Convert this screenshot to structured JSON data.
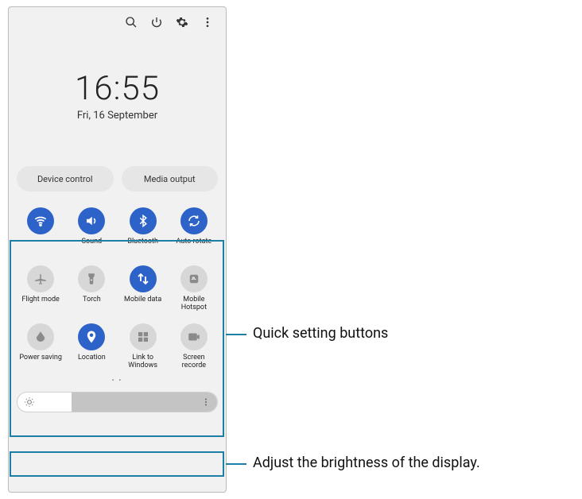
{
  "header": {
    "time": "16:55",
    "date": "Fri, 16 September"
  },
  "chips": {
    "device_control": "Device control",
    "media_output": "Media output"
  },
  "qs": [
    {
      "id": "wifi",
      "label": "",
      "icon": "wifi",
      "on": true
    },
    {
      "id": "sound",
      "label": "Sound",
      "icon": "volume",
      "on": true
    },
    {
      "id": "bluetooth",
      "label": "Bluetooth",
      "icon": "bluetooth",
      "on": true
    },
    {
      "id": "autorotate",
      "label": "Auto rotate",
      "icon": "rotate",
      "on": true
    },
    {
      "id": "flightmode",
      "label": "Flight mode",
      "icon": "plane",
      "on": false
    },
    {
      "id": "torch",
      "label": "Torch",
      "icon": "torch",
      "on": false
    },
    {
      "id": "mobiledata",
      "label": "Mobile data",
      "icon": "data",
      "on": true
    },
    {
      "id": "hotspot",
      "label": "Mobile Hotspot",
      "icon": "hotspot",
      "on": false
    },
    {
      "id": "powersaving",
      "label": "Power saving",
      "icon": "leaf",
      "on": false
    },
    {
      "id": "location",
      "label": "Location",
      "icon": "pin",
      "on": true
    },
    {
      "id": "linkwindows",
      "label": "Link to Windows",
      "icon": "windows",
      "on": false
    },
    {
      "id": "screenrecord",
      "label": "Screen recorde",
      "icon": "record",
      "on": false
    }
  ],
  "page_dots": "• •",
  "brightness": {
    "value_pct": 27
  },
  "annotations": {
    "qs": "Quick setting buttons",
    "brightness": "Adjust the brightness of the display."
  },
  "colors": {
    "accent": "#2d62c9",
    "anno": "#1d7fa6"
  }
}
